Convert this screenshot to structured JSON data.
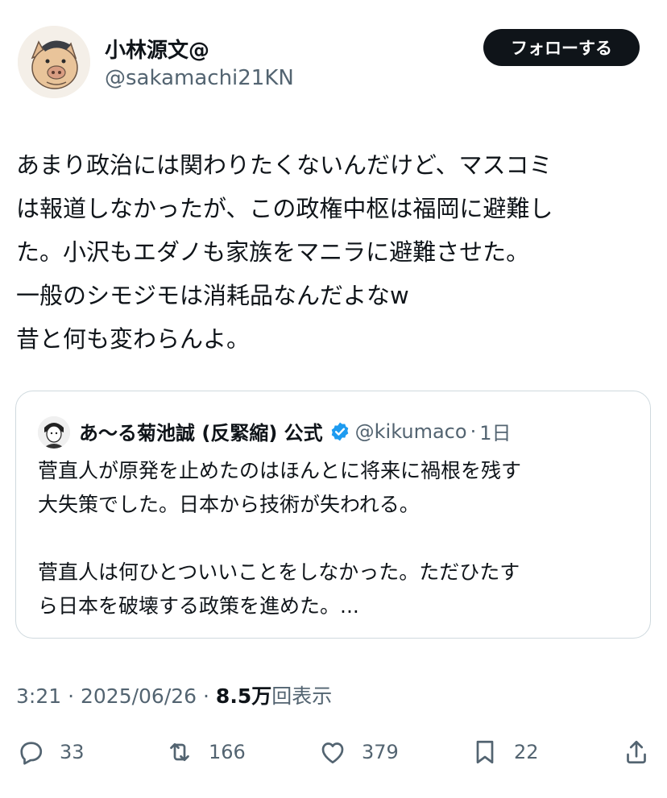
{
  "author": {
    "display_name": "小林源文@",
    "handle": "@sakamachi21KN",
    "follow_label": "フォローする"
  },
  "post": {
    "lines": [
      "あまり政治には関わりたくないんだけど、マスコミ",
      "は報道しなかったが、この政権中枢は福岡に避難し",
      "た。小沢もエダノも家族をマニラに避難させた。",
      "一般のシモジモは消耗品なんだよなw",
      "昔と何も変わらんよ。"
    ]
  },
  "quoted": {
    "display_name": "あ〜る菊池誠 (反緊縮) 公式",
    "handle": "@kikumaco",
    "separator": "·",
    "time": "1日",
    "verified_color": "#1d9bf0",
    "lines": [
      "菅直人が原発を止めたのはほんとに将来に禍根を残す",
      "大失策でした。日本から技術が失われる。",
      "",
      "菅直人は何ひとついいことをしなかった。ただひたす",
      "ら日本を破壊する政策を進めた。..."
    ]
  },
  "meta": {
    "time": "3:21",
    "sep1": " · ",
    "date": "2025/06/26",
    "sep2": " · ",
    "views_count": "8.5万",
    "views_label": "回表示"
  },
  "actions": {
    "replies": "33",
    "reposts": "166",
    "likes": "379",
    "bookmarks": "22"
  }
}
